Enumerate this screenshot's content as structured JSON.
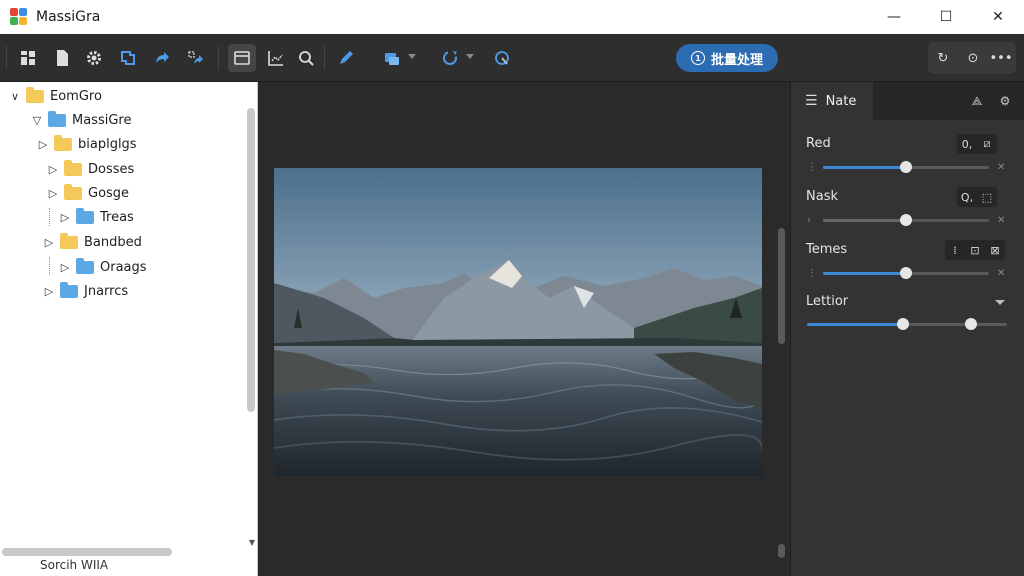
{
  "window": {
    "title": "MassiGra",
    "minimize": "—",
    "maximize": "☐",
    "close": "✕"
  },
  "toolbar": {
    "batch_label": "批量处理",
    "batch_icon_text": "1"
  },
  "tree": {
    "items": [
      {
        "label": "EomGro",
        "toggle": "∨",
        "color": "yellow"
      },
      {
        "label": "MassiGre",
        "toggle": "▽",
        "color": "blue"
      },
      {
        "label": "biaplglgs",
        "toggle": "▷",
        "color": "yellow"
      },
      {
        "label": "Dosses",
        "toggle": "▷",
        "color": "yellow"
      },
      {
        "label": "Gosge",
        "toggle": "▷",
        "color": "yellow"
      },
      {
        "label": "Treas",
        "toggle": "▷",
        "color": "blue"
      },
      {
        "label": "Bandbed",
        "toggle": "▷",
        "color": "yellow"
      },
      {
        "label": "Oraags",
        "toggle": "▷",
        "color": "blue"
      },
      {
        "label": "Jnarrcs",
        "toggle": "▷",
        "color": "blue"
      }
    ],
    "search_text": "Sorcih WIIA"
  },
  "right_panel": {
    "tab_label": "Nate",
    "sections": [
      {
        "label": "Red",
        "buttons": [
          "0,",
          "⧄"
        ],
        "slider_value": 0.5,
        "left_glyph": "⋮",
        "right_glyph": "✕"
      },
      {
        "label": "Nask",
        "buttons": [
          "Q,",
          "⬚"
        ],
        "slider_value": 0.5,
        "left_glyph": "›",
        "right_glyph": "✕"
      },
      {
        "label": "Temes",
        "buttons": [
          "⁞",
          "⊡",
          "⊠"
        ],
        "slider_value": 0.5,
        "left_glyph": "⋮",
        "right_glyph": "✕"
      },
      {
        "label": "Lettior",
        "slider_value": 0.48,
        "slider_value_2": 0.82
      }
    ]
  },
  "colors": {
    "accent": "#2b6cb3",
    "slider_fill": "#3b87d8",
    "folder_yellow": "#f5c85a",
    "folder_blue": "#5aa8e6"
  }
}
